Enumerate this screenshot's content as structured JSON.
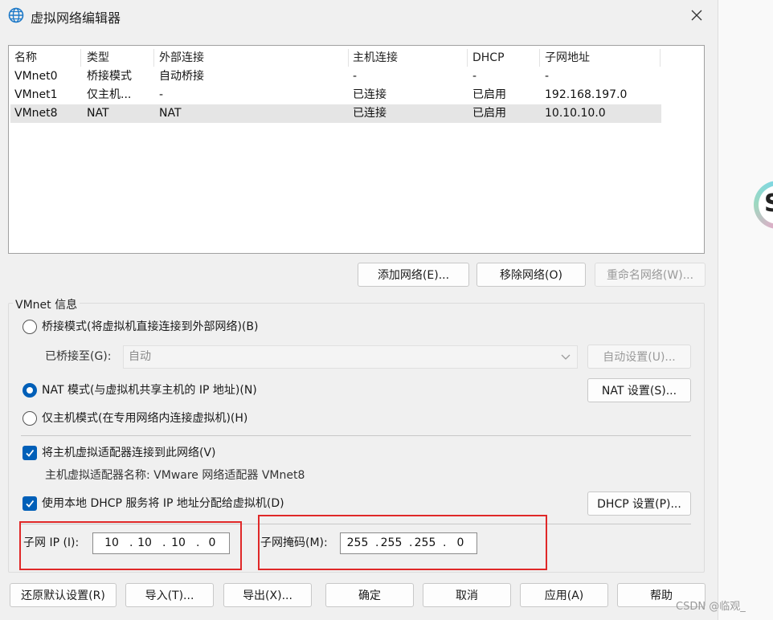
{
  "window": {
    "title": "虚拟网络编辑器"
  },
  "table": {
    "columns": [
      "名称",
      "类型",
      "外部连接",
      "主机连接",
      "DHCP",
      "子网地址"
    ],
    "rows": [
      [
        "VMnet0",
        "桥接模式",
        "自动桥接",
        "-",
        "-",
        "-"
      ],
      [
        "VMnet1",
        "仅主机...",
        "-",
        "已连接",
        "已启用",
        "192.168.197.0"
      ],
      [
        "VMnet8",
        "NAT",
        "NAT",
        "已连接",
        "已启用",
        "10.10.10.0"
      ]
    ],
    "selected_row": 2
  },
  "table_buttons": {
    "add": "添加网络(E)...",
    "remove": "移除网络(O)",
    "rename": "重命名网络(W)..."
  },
  "vmnet_info": {
    "group_label": "VMnet 信息",
    "bridged_mode": "桥接模式(将虚拟机直接连接到外部网络)(B)",
    "bridged_to_label": "已桥接至(G):",
    "bridged_to_value": "自动",
    "auto_settings": "自动设置(U)...",
    "nat_mode": "NAT 模式(与虚拟机共享主机的 IP 地址)(N)",
    "nat_settings": "NAT 设置(S)...",
    "host_only_mode": "仅主机模式(在专用网络内连接虚拟机)(H)",
    "selected_mode": "nat",
    "connect_adapter": "将主机虚拟适配器连接到此网络(V)",
    "connect_adapter_checked": true,
    "adapter_name": "主机虚拟适配器名称: VMware 网络适配器 VMnet8",
    "use_dhcp": "使用本地 DHCP 服务将 IP 地址分配给虚拟机(D)",
    "use_dhcp_checked": true,
    "dhcp_settings": "DHCP 设置(P)...",
    "subnet_ip_label": "子网 IP (I):",
    "subnet_ip": [
      "10",
      "10",
      "10",
      "0"
    ],
    "subnet_mask_label": "子网掩码(M):",
    "subnet_mask": [
      "255",
      "255",
      "255",
      "0"
    ]
  },
  "footer_buttons": {
    "restore": "还原默认设置(R)",
    "import": "导入(T)...",
    "export": "导出(X)...",
    "ok": "确定",
    "cancel": "取消",
    "apply": "应用(A)",
    "help": "帮助"
  },
  "watermark": "CSDN @临观_",
  "colors": {
    "accent": "#005fb8",
    "highlight_box": "#e02828",
    "selected_row": "#e5e5e5"
  }
}
